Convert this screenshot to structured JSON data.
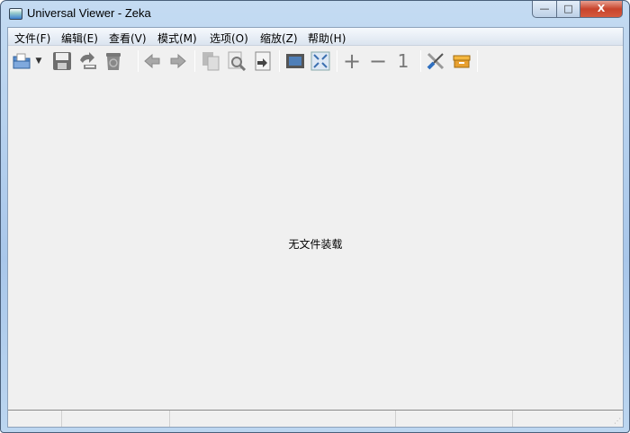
{
  "window": {
    "title": "Universal Viewer - Zeka",
    "minimize": "—",
    "maximize": "□",
    "close": "X"
  },
  "menu": [
    "文件(F)",
    "编辑(E)",
    "查看(V)",
    "模式(M)",
    "选项(O)",
    "缩放(Z)",
    "帮助(H)"
  ],
  "toolbar": {
    "zoom_in": "+",
    "zoom_out": "−",
    "actual_size": "1"
  },
  "main": {
    "empty_message": "无文件装载"
  },
  "colors": {
    "accent": "#3b7fd0"
  }
}
